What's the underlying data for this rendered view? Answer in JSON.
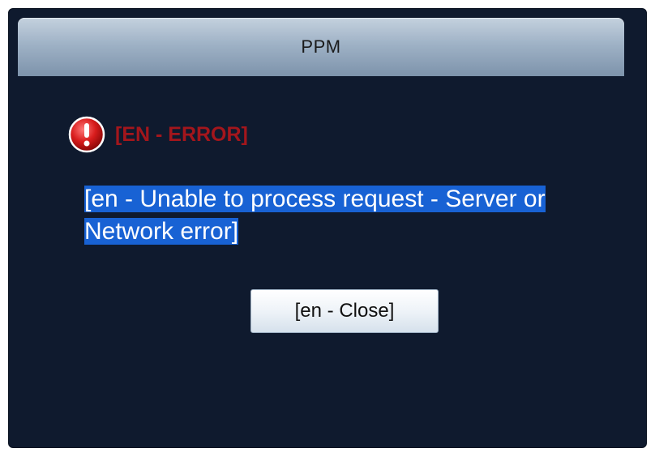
{
  "dialog": {
    "title": "PPM",
    "error_label": "[EN - ERROR]",
    "error_icon": "error-exclamation-icon",
    "message": "[en - Unable to process request - Server or Network error]",
    "close_label": "[en - Close]"
  },
  "colors": {
    "dialog_background": "#0f1a2e",
    "error_text": "#a3161c",
    "selection_highlight": "#1862d4"
  }
}
